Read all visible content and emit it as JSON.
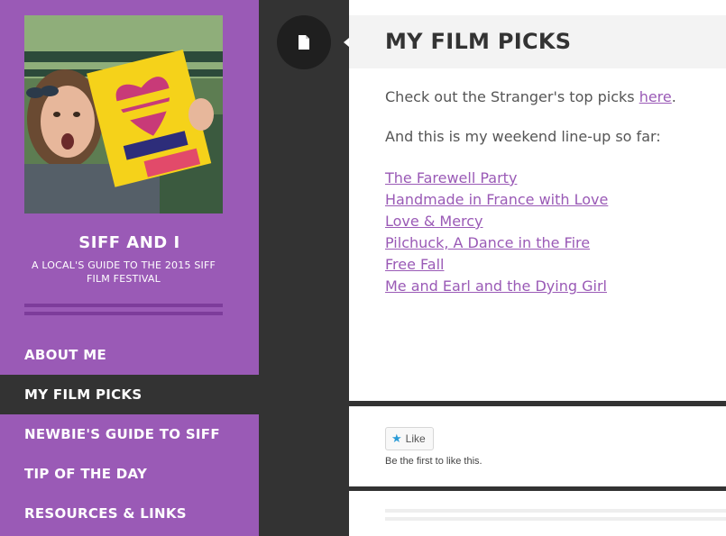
{
  "site": {
    "title": "SIFF AND I",
    "description": "A LOCAL'S GUIDE TO THE 2015 SIFF FILM FESTIVAL"
  },
  "nav": {
    "items": [
      {
        "label": "ABOUT ME",
        "active": false
      },
      {
        "label": "MY FILM PICKS",
        "active": true
      },
      {
        "label": "NEWBIE'S GUIDE TO SIFF",
        "active": false
      },
      {
        "label": "TIP OF THE DAY",
        "active": false
      },
      {
        "label": "RESOURCES & LINKS",
        "active": false
      }
    ]
  },
  "post": {
    "title": "MY FILM PICKS",
    "intro_prefix": "Check out the Stranger's top picks ",
    "intro_link": "here",
    "intro_suffix": ".",
    "lineup_text": "And this is my weekend line-up so far:",
    "films": [
      "The Farewell Party",
      "Handmade in France with Love",
      "Love & Mercy",
      "Pilchuck, A Dance in the Fire",
      "Free Fall",
      "Me and Earl and the Dying Girl"
    ]
  },
  "like": {
    "button_label": "Like",
    "note": "Be the first to like this."
  },
  "icons": {
    "post_format": "document-icon",
    "like": "star-icon"
  },
  "colors": {
    "accent": "#9a5ab6",
    "accent_dark": "#7d3c9b",
    "dark": "#333333",
    "like_star": "#2a9bd6"
  }
}
